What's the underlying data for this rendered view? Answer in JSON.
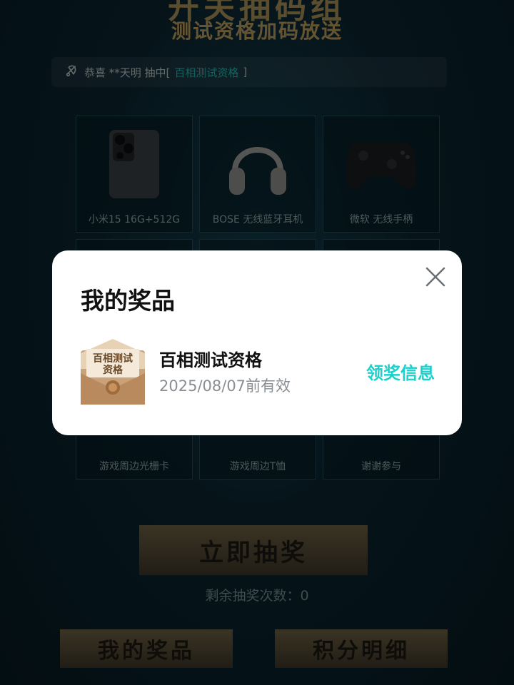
{
  "header": {
    "title_partial": "开关抽码组",
    "subtitle": "测试资格加码放送"
  },
  "marquee": {
    "prefix": "恭喜 **天明 抽中[",
    "highlight": "百相测试资格",
    "suffix": "]"
  },
  "prizes": [
    {
      "label": "小米15 16G+512G",
      "icon": "phone-icon"
    },
    {
      "label": "BOSE 无线蓝牙耳机",
      "icon": "headphones-icon"
    },
    {
      "label": "微软 无线手柄",
      "icon": "gamepad-icon"
    },
    {
      "label": "",
      "icon": "prize-icon"
    },
    {
      "label": "",
      "icon": "prize-icon"
    },
    {
      "label": "",
      "icon": "prize-icon"
    },
    {
      "label": "游戏周边光栅卡",
      "icon": "card-icon"
    },
    {
      "label": "游戏周边T恤",
      "icon": "tshirt-icon"
    },
    {
      "label": "谢谢参与",
      "icon": "thanks-icon"
    }
  ],
  "draw_button": "立即抽奖",
  "remaining": "剩余抽奖次数：0",
  "bottom_buttons": {
    "my_prizes": "我的奖品",
    "points_detail": "积分明细"
  },
  "modal": {
    "title": "我的奖品",
    "item": {
      "thumb_text": "百相测试资格",
      "name": "百相测试资格",
      "expiry": "2025/08/07前有效",
      "claim_label": "领奖信息"
    }
  },
  "colors": {
    "accent": "#1ad1cc",
    "marquee_highlight": "#22b7b0",
    "gold": "#b89a5a"
  }
}
